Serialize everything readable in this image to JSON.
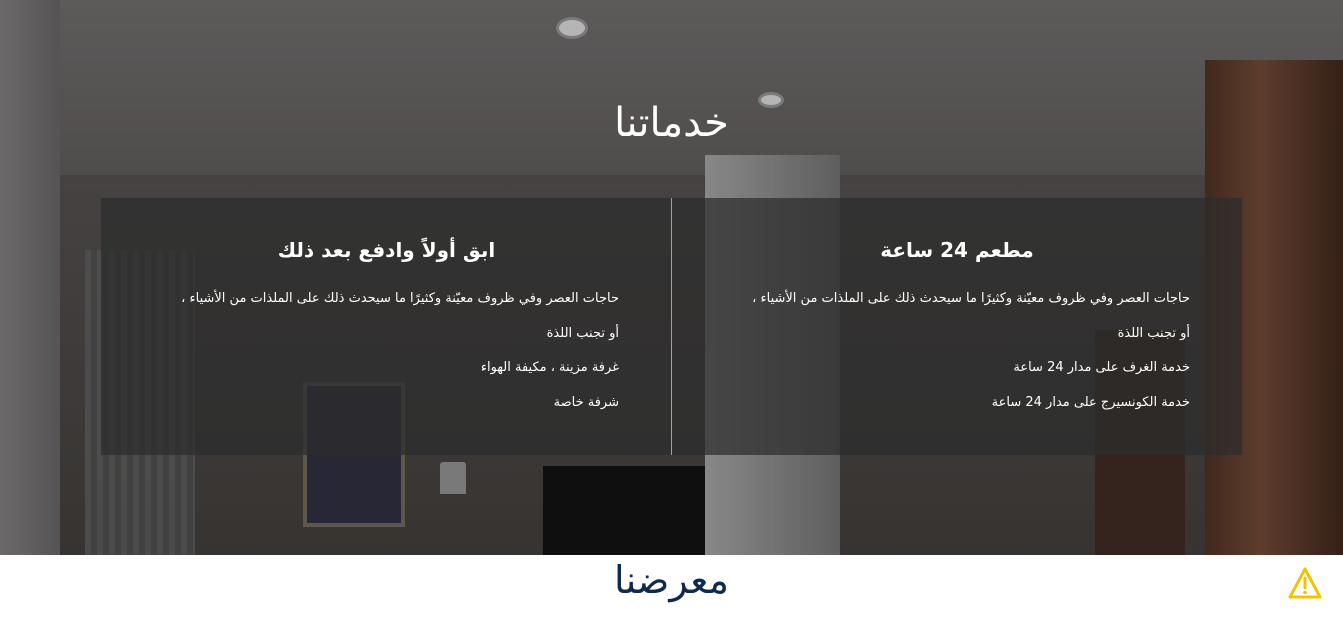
{
  "services_section": {
    "title": "خدماتنا",
    "cards": [
      {
        "title": "مطعم 24 ساعة",
        "description": "حاجات العصر وفي ظروف معيّنة وكثيرًا ما سيحدث ذلك على الملذات من الأشياء ، أو تجنب اللذة",
        "features": [
          "خدمة الغرف على مدار 24 ساعة",
          "خدمة الكونسيرج على مدار 24 ساعة"
        ]
      },
      {
        "title": "ابق أولاً وادفع بعد ذلك",
        "description": "حاجات العصر وفي ظروف معيّنة وكثيرًا ما سيحدث ذلك على الملذات من الأشياء ، أو تجنب اللذة",
        "features": [
          "غرفة مزينة ، مكيفة الهواء",
          "شرفة خاصة"
        ]
      }
    ]
  },
  "gallery_section": {
    "title": "معرضنا"
  },
  "icons": {
    "warning": "warning-triangle-icon"
  },
  "colors": {
    "gallery_title": "#0e2a4e",
    "warning_icon": "#f2c400"
  }
}
